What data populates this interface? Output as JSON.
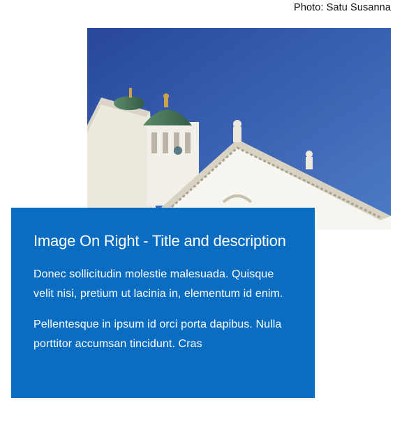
{
  "photo_credit": "Photo: Satu Susanna",
  "image": {
    "subject": "white cathedral with green domes against blue sky",
    "sky_color": "#2f5aa8",
    "building_color": "#f4f1ea",
    "dome_color": "#4d7a5a"
  },
  "card": {
    "title": "Image On Right - Title and description",
    "paragraph_1": "Donec sollicitudin molestie malesuada. Quisque velit nisi, pretium ut lacinia in, elementum id enim.",
    "paragraph_2": "Pellentesque in ipsum id orci porta dapibus. Nulla porttitor accumsan tincidunt. Cras",
    "background": "#0a6dc2"
  }
}
